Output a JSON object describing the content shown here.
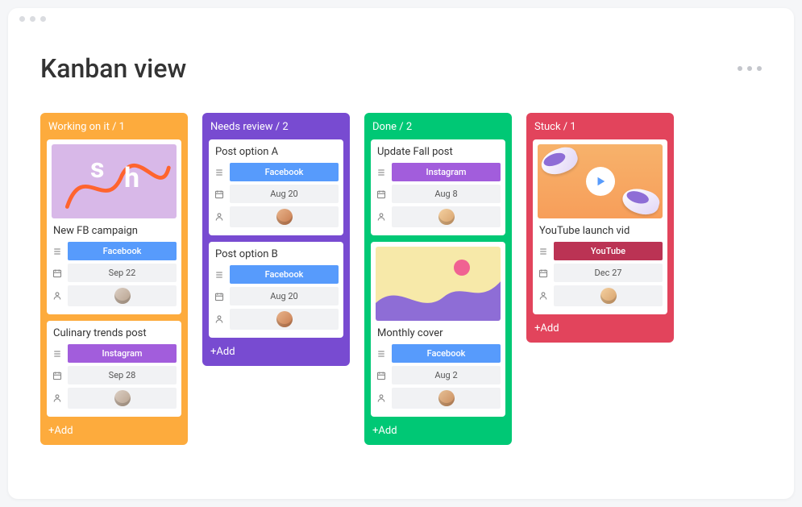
{
  "page": {
    "title": "Kanban view"
  },
  "add_label": "+Add",
  "columns": [
    {
      "id": "working",
      "header": "Working on it / 1",
      "color": "col-orange",
      "cards": [
        {
          "title": "New FB campaign",
          "thumb": "fb",
          "channel": {
            "label": "Facebook",
            "class": "pill-facebook"
          },
          "date": "Sep 22",
          "avatar": "a4"
        },
        {
          "title": "Culinary trends post",
          "channel": {
            "label": "Instagram",
            "class": "pill-instagram"
          },
          "date": "Sep 28",
          "avatar": "a4"
        }
      ]
    },
    {
      "id": "review",
      "header": "Needs review / 2",
      "color": "col-purple",
      "cards": [
        {
          "title": "Post option A",
          "channel": {
            "label": "Facebook",
            "class": "pill-facebook"
          },
          "date": "Aug 20",
          "avatar": "a2"
        },
        {
          "title": "Post option B",
          "channel": {
            "label": "Facebook",
            "class": "pill-facebook"
          },
          "date": "Aug 20",
          "avatar": "a2"
        }
      ]
    },
    {
      "id": "done",
      "header": "Done / 2",
      "color": "col-green",
      "cards": [
        {
          "title": "Update Fall post",
          "channel": {
            "label": "Instagram",
            "class": "pill-instagram"
          },
          "date": "Aug 8",
          "avatar": "a3"
        },
        {
          "title": "Monthly cover",
          "thumb": "cover",
          "channel": {
            "label": "Facebook",
            "class": "pill-facebook"
          },
          "date": "Aug 2",
          "avatar": "a5"
        }
      ]
    },
    {
      "id": "stuck",
      "header": "Stuck / 1",
      "color": "col-red",
      "cards": [
        {
          "title": "YouTube launch vid",
          "thumb": "video",
          "channel": {
            "label": "YouTube",
            "class": "pill-youtube"
          },
          "date": "Dec 27",
          "avatar": "a3"
        }
      ]
    }
  ]
}
